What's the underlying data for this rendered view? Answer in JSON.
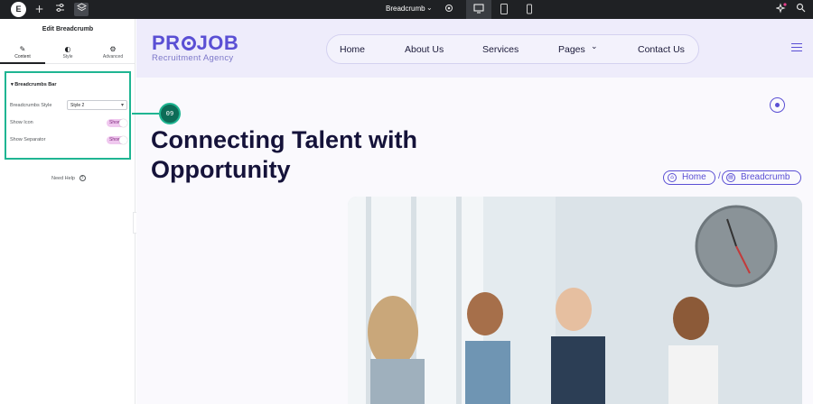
{
  "editor": {
    "topbar": {
      "logo": "E",
      "document_title": "Breadcrumb",
      "devices": [
        "desktop",
        "tablet",
        "mobile"
      ]
    },
    "panel": {
      "title": "Edit Breadcrumb",
      "tabs": [
        {
          "label": "Content",
          "icon": "pencil-icon"
        },
        {
          "label": "Style",
          "icon": "contrast-icon"
        },
        {
          "label": "Advanced",
          "icon": "gear-icon"
        }
      ],
      "section": {
        "title": "Breadcrumbs Bar",
        "style_label": "Breadcrumbs Style",
        "style_value": "Style 2",
        "show_icon_label": "Show Icon",
        "show_icon_value": "Show",
        "show_separator_label": "Show Separator",
        "show_separator_value": "Show"
      },
      "need_help": "Need Help",
      "help_icon": "?"
    },
    "callout": "09",
    "accent_color": "#1fb592"
  },
  "site": {
    "brand": {
      "name_a": "PR",
      "name_b": "JOB",
      "tagline": "Recruitment Agency"
    },
    "nav": [
      "Home",
      "About Us",
      "Services",
      "Pages",
      "Contact Us"
    ],
    "hero_title_line1": "Connecting Talent with",
    "hero_title_line2": "Opportunity",
    "breadcrumbs": [
      {
        "label": "Home",
        "icon": "home-icon"
      },
      {
        "label": "Breadcrumb",
        "icon": "page-icon"
      }
    ],
    "breadcrumb_separator": "/",
    "brand_color": "#5a4fd4"
  }
}
